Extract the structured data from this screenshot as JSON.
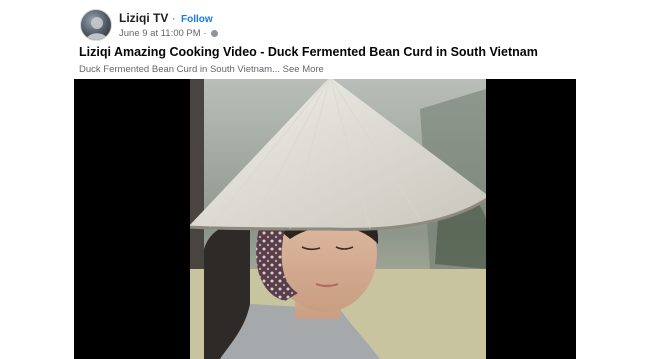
{
  "post": {
    "author": "Liziqi TV",
    "separator": "·",
    "follow_label": "Follow",
    "timestamp": "June 9 at 11:00 PM ·",
    "title": "Liziqi Amazing Cooking Video - Duck Fermented Bean Curd in South Vietnam",
    "description": "Duck Fermented Bean Curd in South Vietnam...",
    "see_more_label": "See More"
  },
  "icons": {
    "privacy": "globe-icon"
  },
  "colors": {
    "link": "#1877f2",
    "secondary_text": "#65676b",
    "primary_text": "#050505",
    "video_background": "#000000"
  }
}
